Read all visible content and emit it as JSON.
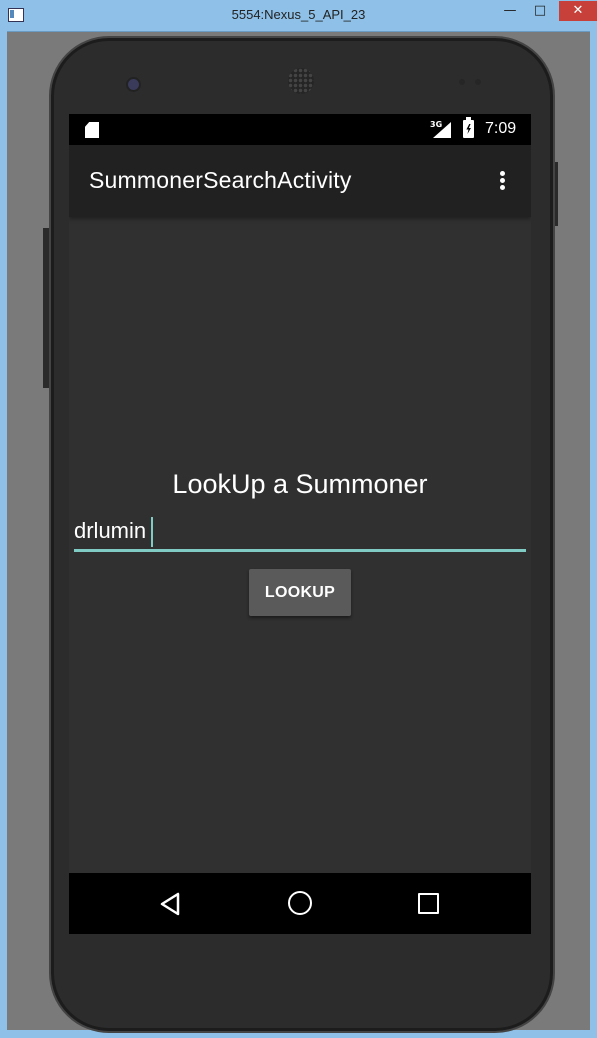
{
  "window": {
    "title": "5554:Nexus_5_API_23",
    "minimize_label": "—",
    "maximize_label": "□",
    "close_label": "✕"
  },
  "status_bar": {
    "network_label": "3G",
    "time": "7:09"
  },
  "app_bar": {
    "title": "SummonerSearchActivity"
  },
  "main": {
    "heading": "LookUp a Summoner",
    "summoner_input_value": "drlumin",
    "lookup_button_label": "LOOKUP"
  },
  "colors": {
    "accent": "#80cbc4",
    "background": "#303030",
    "app_bar": "#212121",
    "button": "#5a5a5a"
  },
  "icons": {
    "sd_card": "sd-card-icon",
    "signal": "signal-icon",
    "battery": "battery-charging-icon",
    "overflow": "overflow-menu-icon",
    "back": "back-icon",
    "home": "home-icon",
    "recent": "recent-apps-icon"
  }
}
